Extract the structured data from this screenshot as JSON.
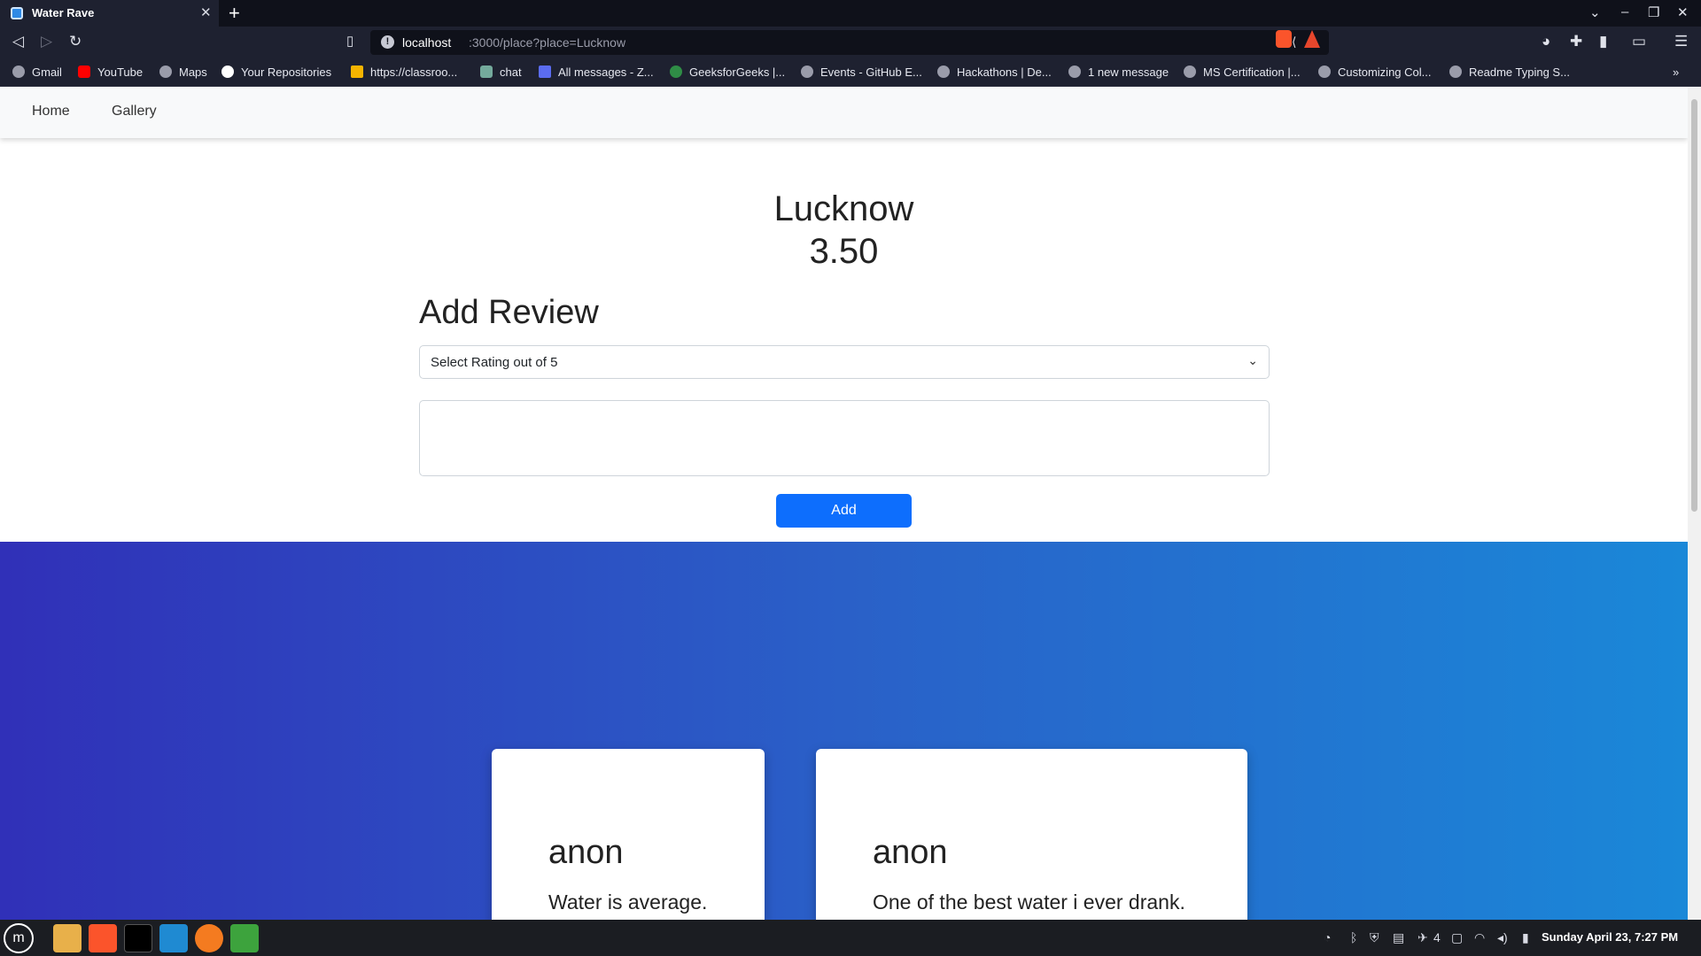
{
  "browser": {
    "tab_title": "Water Rave",
    "url_host": "localhost",
    "url_path": ":3000/place?place=Lucknow",
    "bookmarks": [
      "Gmail",
      "YouTube",
      "Maps",
      "Your Repositories",
      "https://classroo...",
      "chat",
      "All messages - Z...",
      "GeeksforGeeks |...",
      "Events - GitHub E...",
      "Hackathons | De...",
      "1 new message",
      "MS Certification |...",
      "Customizing Col...",
      "Readme Typing S..."
    ]
  },
  "site": {
    "nav": [
      "Home",
      "Gallery"
    ],
    "place_name": "Lucknow",
    "place_rating": "3.50",
    "add_review_title": "Add Review",
    "rating_select_value": "Select Rating out of 5",
    "add_button": "Add",
    "reviews": [
      {
        "author": "anon",
        "comment": "Water is average."
      },
      {
        "author": "anon",
        "comment": "One of the best water i ever drank."
      }
    ]
  },
  "taskbar": {
    "tray_count": "4",
    "clock": "Sunday April 23, 7:27 PM"
  },
  "colors": {
    "primary_button": "#0d6efd",
    "gradient_start": "#3030b8",
    "gradient_end": "#1a88d8"
  }
}
